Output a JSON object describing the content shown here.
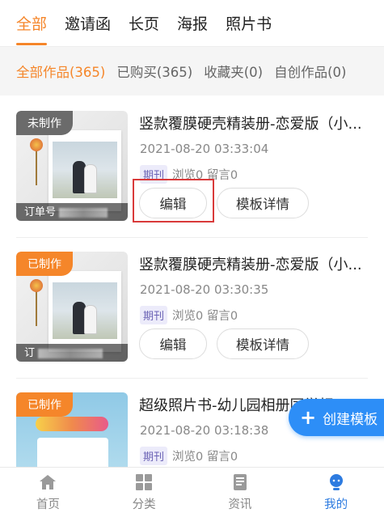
{
  "top_tabs": [
    {
      "label": "全部",
      "active": true
    },
    {
      "label": "邀请函",
      "active": false
    },
    {
      "label": "长页",
      "active": false
    },
    {
      "label": "海报",
      "active": false
    },
    {
      "label": "照片书",
      "active": false
    }
  ],
  "filters": [
    {
      "label": "全部作品(365)",
      "active": true
    },
    {
      "label": "已购买(365)",
      "active": false
    },
    {
      "label": "收藏夹(0)",
      "active": false
    },
    {
      "label": "自创作品(0)",
      "active": false
    }
  ],
  "cards": [
    {
      "badge": "未制作",
      "order_label": "订单号",
      "title": "竖款覆膜硬壳精装册-恋爱版（小...",
      "date": "2021-08-20 03:33:04",
      "tag": "期刊",
      "stats": "浏览0 留言0",
      "edit_label": "编辑",
      "detail_label": "模板详情"
    },
    {
      "badge": "已制作",
      "order_label": "订",
      "title": "竖款覆膜硬壳精装册-恋爱版（小...",
      "date": "2021-08-20 03:30:35",
      "tag": "期刊",
      "stats": "浏览0 留言0",
      "edit_label": "编辑",
      "detail_label": "模板详情"
    },
    {
      "badge": "已制作",
      "title": "超级照片书-幼儿园相册同学相册...",
      "date": "2021-08-20 03:18:38",
      "tag": "期刊",
      "stats": "浏览0 留言0"
    }
  ],
  "fab": {
    "icon": "plus-icon",
    "label": "创建模板"
  },
  "bottom_nav": [
    {
      "label": "首页",
      "icon": "home-icon",
      "active": false
    },
    {
      "label": "分类",
      "icon": "grid-icon",
      "active": false
    },
    {
      "label": "资讯",
      "icon": "news-icon",
      "active": false
    },
    {
      "label": "我的",
      "icon": "profile-icon",
      "active": true
    }
  ],
  "colors": {
    "accent": "#f5862a",
    "primary_blue": "#2d8ef7",
    "highlight_red": "#d93a3a"
  }
}
